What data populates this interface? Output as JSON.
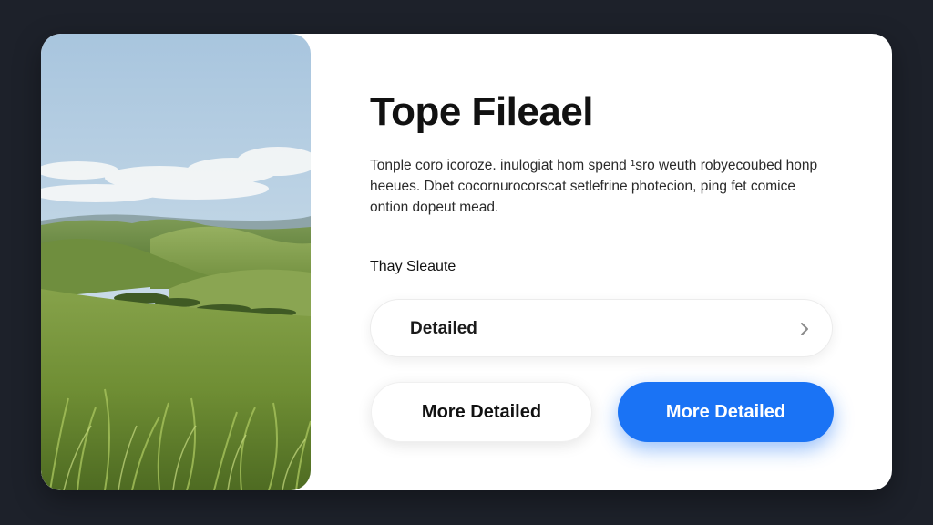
{
  "card": {
    "title": "Tope Fileael",
    "description": "Tonple coro icoroze. inulogiat hom spend ¹sro weuth robyecoubed honp heeues. Dbet cocornurocorscat setlefrine photecion, ping fet comice ontion dopeut mead.",
    "section_label": "Thay Sleaute",
    "select": {
      "label": "Detailed",
      "icon": "chevron-right-icon"
    },
    "buttons": {
      "secondary_label": "More Detailed",
      "primary_label": "More Detailed"
    }
  },
  "colors": {
    "background": "#1d212a",
    "card": "#ffffff",
    "primary": "#1a73f5",
    "text": "#111111"
  }
}
